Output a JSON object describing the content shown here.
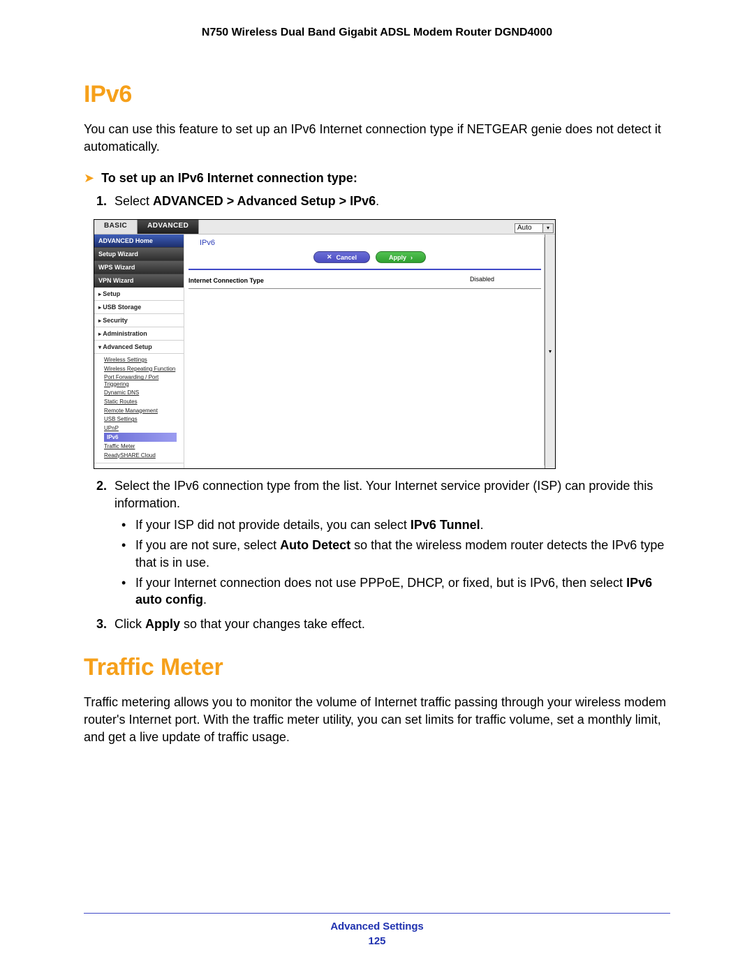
{
  "header": {
    "title": "N750 Wireless Dual Band Gigabit ADSL Modem Router DGND4000"
  },
  "section1": {
    "title": "IPv6",
    "intro": "You can use this feature to set up an IPv6 Internet connection type if NETGEAR genie does not detect it automatically.",
    "procHeading": "To set up an IPv6 Internet connection type:",
    "step1_prefix": "Select ",
    "step1_bold": "ADVANCED > Advanced Setup > IPv6",
    "step1_suffix": ".",
    "step2": "Select the IPv6 connection type from the list. Your Internet service provider (ISP) can provide this information.",
    "bullet1_prefix": "If your ISP did not provide details, you can select ",
    "bullet1_bold": "IPv6 Tunnel",
    "bullet1_suffix": ".",
    "bullet2_prefix": "If you are not sure, select ",
    "bullet2_bold": "Auto Detect",
    "bullet2_suffix": " so that the wireless modem router detects the IPv6 type that is in use.",
    "bullet3_prefix": "If your Internet connection does not use PPPoE, DHCP, or fixed, but is IPv6, then select ",
    "bullet3_bold": "IPv6 auto config",
    "bullet3_suffix": ".",
    "step3_prefix": "Click ",
    "step3_bold": "Apply",
    "step3_suffix": " so that your changes take effect."
  },
  "figure": {
    "tabs": {
      "basic": "BASIC",
      "advanced": "ADVANCED"
    },
    "autoSelect": "Auto",
    "nav": {
      "home": "ADVANCED Home",
      "setupWizard": "Setup Wizard",
      "wpsWizard": "WPS Wizard",
      "vpnWizard": "VPN Wizard",
      "groups": [
        "Setup",
        "USB Storage",
        "Security",
        "Administration",
        "Advanced Setup"
      ],
      "advSetupItems": [
        "Wireless Settings",
        "Wireless Repeating Function",
        "Port Forwarding / Port Triggering",
        "Dynamic DNS",
        "Static Routes",
        "Remote Management",
        "USB Settings",
        "UPnP",
        "IPv6",
        "Traffic Meter",
        "ReadySHARE Cloud"
      ]
    },
    "mainTitle": "IPv6",
    "buttons": {
      "cancel": "Cancel",
      "apply": "Apply"
    },
    "rowLabel": "Internet Connection Type",
    "rowValue": "Disabled"
  },
  "section2": {
    "title": "Traffic Meter",
    "intro": "Traffic metering allows you to monitor the volume of Internet traffic passing through your wireless modem router's Internet port. With the traffic meter utility, you can set limits for traffic volume, set a monthly limit, and get a live update of traffic usage."
  },
  "footer": {
    "chapter": "Advanced Settings",
    "page": "125"
  }
}
